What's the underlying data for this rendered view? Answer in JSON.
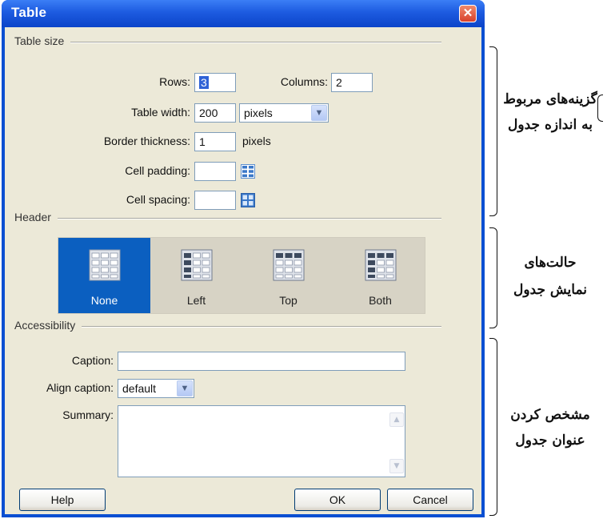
{
  "dialog": {
    "title": "Table",
    "close_glyph": "✕"
  },
  "table_size": {
    "group_label": "Table size",
    "rows_label": "Rows:",
    "rows_value": "3",
    "columns_label": "Columns:",
    "columns_value": "2",
    "width_label": "Table width:",
    "width_value": "200",
    "width_unit": "pixels",
    "border_label": "Border thickness:",
    "border_value": "1",
    "border_unit": "pixels",
    "padding_label": "Cell padding:",
    "padding_value": "",
    "spacing_label": "Cell spacing:",
    "spacing_value": ""
  },
  "header": {
    "group_label": "Header",
    "options": [
      {
        "label": "None",
        "selected": true
      },
      {
        "label": "Left",
        "selected": false
      },
      {
        "label": "Top",
        "selected": false
      },
      {
        "label": "Both",
        "selected": false
      }
    ]
  },
  "accessibility": {
    "group_label": "Accessibility",
    "caption_label": "Caption:",
    "caption_value": "",
    "align_label": "Align caption:",
    "align_value": "default",
    "summary_label": "Summary:",
    "summary_value": ""
  },
  "buttons": {
    "help": "Help",
    "ok": "OK",
    "cancel": "Cancel"
  },
  "annotations": {
    "size_line1": "گزینه‌های مربوط",
    "size_line2": "به اندازه جدول",
    "header_line1": "حالت‌های",
    "header_line2": "نمایش جدول",
    "caption_line1": "مشخص کردن",
    "caption_line2": "عنوان جدول"
  },
  "colors": {
    "title_bar": "#1d5be0",
    "selected_tile": "#0b5fc0",
    "client_bg": "#ece9d8"
  }
}
